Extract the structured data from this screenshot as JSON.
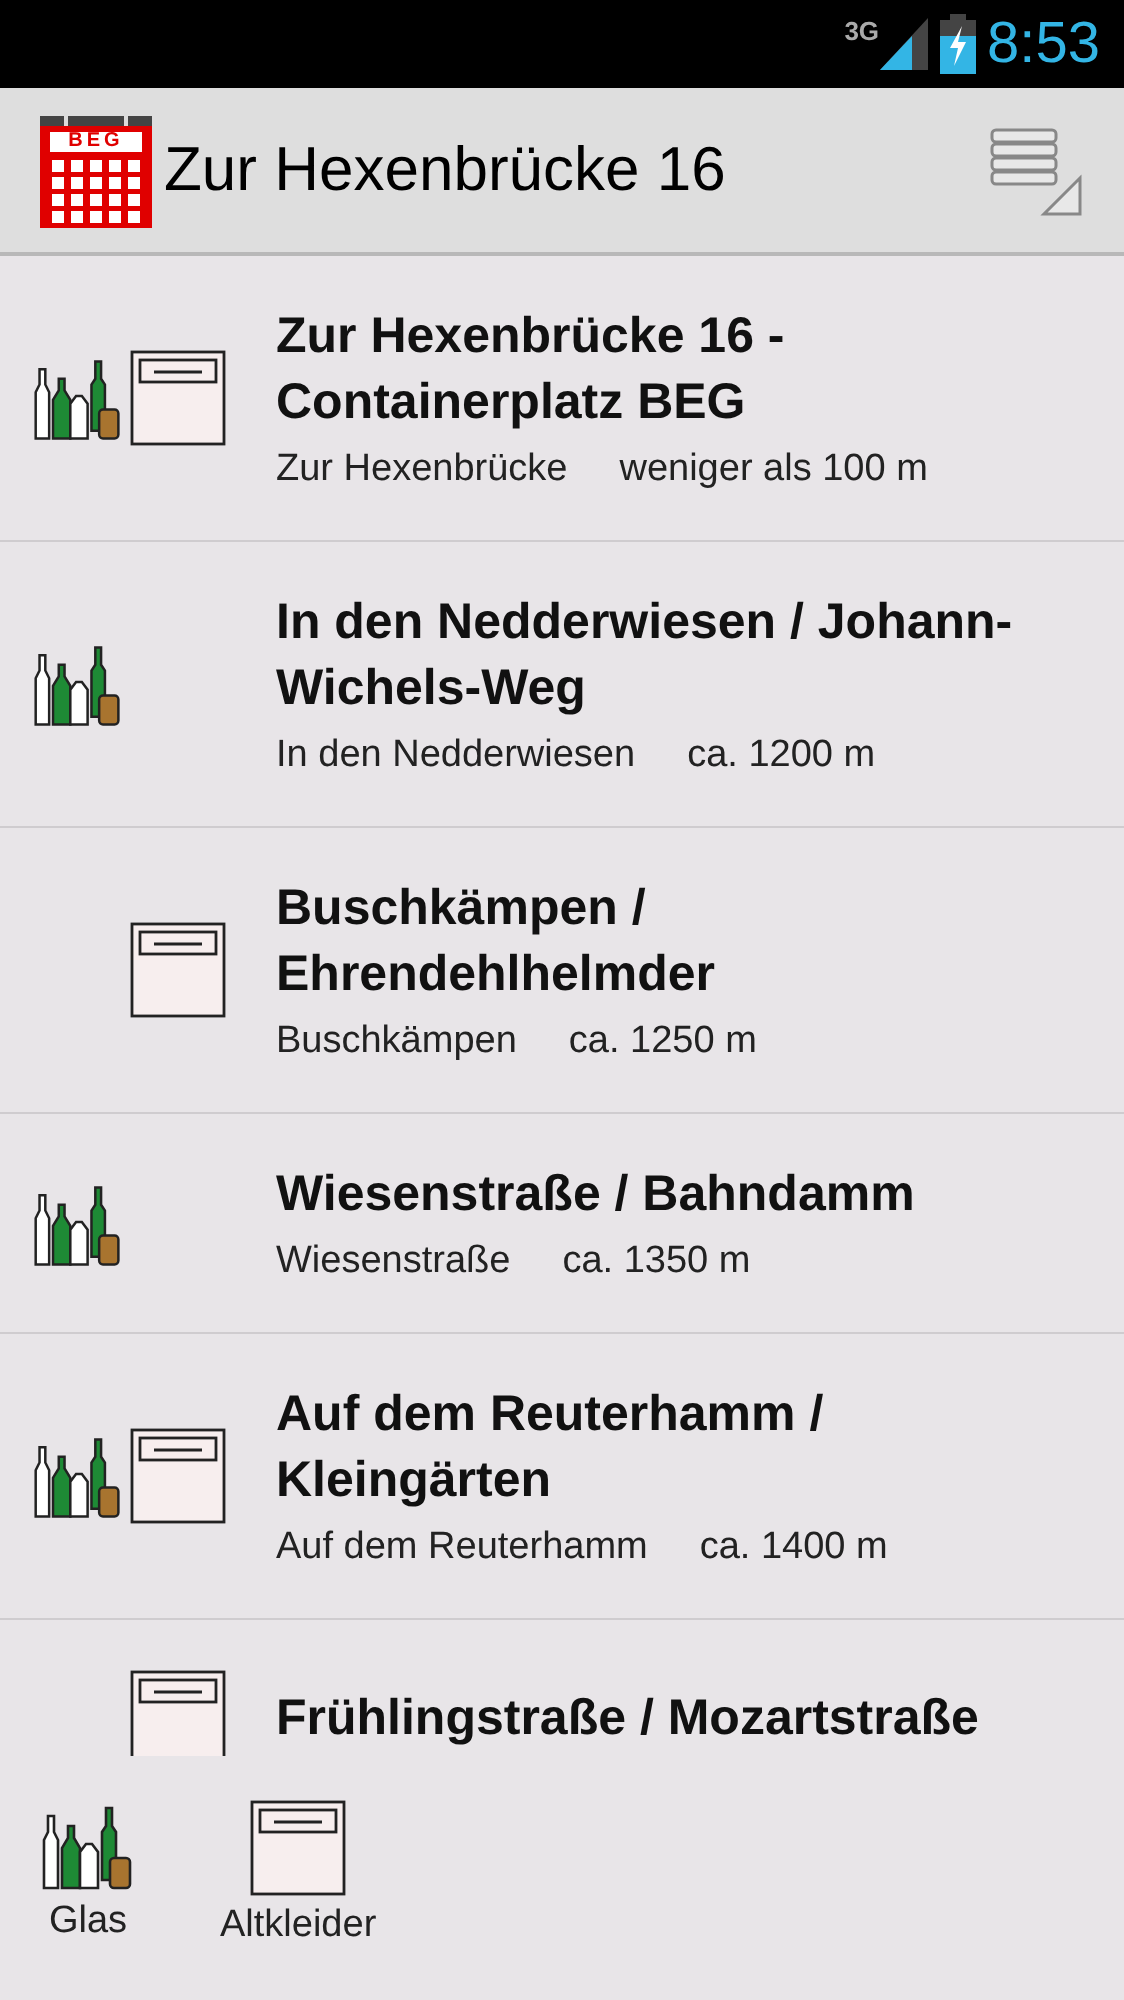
{
  "status_bar": {
    "network": "3G",
    "time": "8:53"
  },
  "app_bar": {
    "title": "Zur Hexenbrücke 16",
    "logo": "BEG"
  },
  "locations": [
    {
      "title": "Zur Hexenbrücke 16 - Containerplatz BEG",
      "street": "Zur Hexenbrücke",
      "distance": "weniger als 100 m",
      "glass": true,
      "clothes": true
    },
    {
      "title": "In den Nedderwiesen / Johann-Wichels-Weg",
      "street": "In den Nedderwiesen",
      "distance": "ca. 1200 m",
      "glass": true,
      "clothes": false
    },
    {
      "title": "Buschkämpen / Ehrendehlhelmder",
      "street": "Buschkämpen",
      "distance": "ca. 1250 m",
      "glass": false,
      "clothes": true
    },
    {
      "title": "Wiesenstraße / Bahndamm",
      "street": "Wiesenstraße",
      "distance": "ca. 1350 m",
      "glass": true,
      "clothes": false
    },
    {
      "title": "Auf dem Reuterhamm / Kleingärten",
      "street": "Auf dem Reuterhamm",
      "distance": "ca. 1400 m",
      "glass": true,
      "clothes": true
    },
    {
      "title": "Frühlingstraße / Mozartstraße",
      "glass": false,
      "clothes": true
    }
  ],
  "legend": [
    {
      "kind": "glass",
      "label": "Glas"
    },
    {
      "kind": "clothes",
      "label": "Altkleider"
    }
  ]
}
